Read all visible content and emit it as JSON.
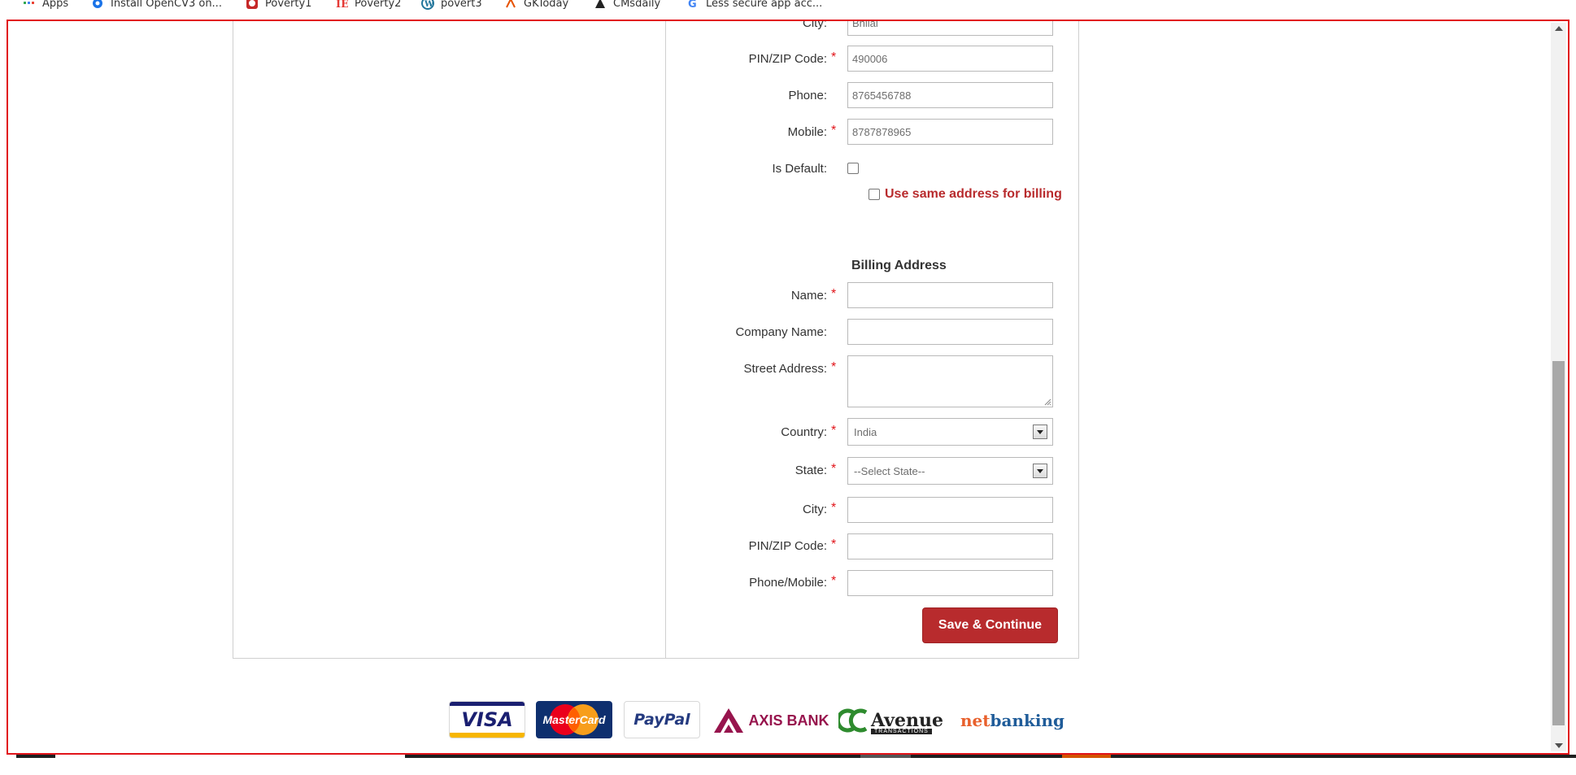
{
  "bookmarks": [
    {
      "label": "Apps",
      "icon": "apps-grid-icon"
    },
    {
      "label": "Install OpenCV3 on...",
      "icon": "opencv-icon"
    },
    {
      "label": "Poverty1",
      "icon": "poverty1-icon"
    },
    {
      "label": "Poverty2",
      "icon": "poverty2-icon"
    },
    {
      "label": "povert3",
      "icon": "wordpress-icon"
    },
    {
      "label": "GKToday",
      "icon": "gktoday-icon"
    },
    {
      "label": "CMsdaily",
      "icon": "cmsdaily-icon"
    },
    {
      "label": "Less secure app acc...",
      "icon": "google-icon"
    }
  ],
  "shipping": {
    "city_label": "City:",
    "city_value": "Bhilai",
    "pin_label": "PIN/ZIP Code:",
    "pin_value": "490006",
    "phone_label": "Phone:",
    "phone_value": "8765456788",
    "mobile_label": "Mobile:",
    "mobile_value": "8787878965",
    "is_default_label": "Is Default:",
    "same_address_label": "Use same address for billing"
  },
  "billing": {
    "title": "Billing Address",
    "name_label": "Name:",
    "company_label": "Company Name:",
    "street_label": "Street Address:",
    "country_label": "Country:",
    "country_value": "India",
    "state_label": "State:",
    "state_value": "--Select State--",
    "city_label": "City:",
    "pin_label": "PIN/ZIP Code:",
    "phone_label": "Phone/Mobile:",
    "save_button": "Save & Continue"
  },
  "required_marker": "*",
  "payment_logos": {
    "visa": "VISA",
    "mastercard": "MasterCard",
    "paypal": "PayPal",
    "axis": "AXIS BANK",
    "ccavenue": "Avenue",
    "ccavenue_sub": "TRANSACTIONS",
    "netbanking_net": "net",
    "netbanking_banking": "banking"
  },
  "colors": {
    "accent": "#b82b2d",
    "required": "#e1141a",
    "frame": "#e1141a"
  }
}
